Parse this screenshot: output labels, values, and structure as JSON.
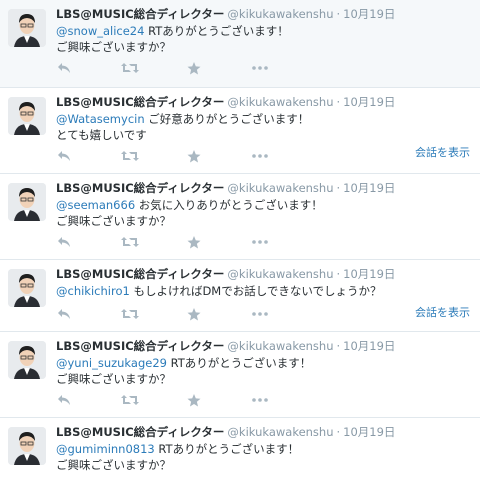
{
  "tweets": [
    {
      "name": "LBS@MUSIC総合ディレクター",
      "handle": "@kikukawakenshu",
      "separator": "·",
      "date": "10月19日",
      "mention": "@snow_alice24",
      "text1": " RTありがとうございます！",
      "text2": "ご興味ございますか？",
      "show_conversation": ""
    },
    {
      "name": "LBS@MUSIC総合ディレクター",
      "handle": "@kikukawakenshu",
      "separator": "·",
      "date": "10月19日",
      "mention": "@Watasemycin",
      "text1": " ご好意ありがとうございます！",
      "text2": "とても嬉しいです",
      "show_conversation": "会話を表示"
    },
    {
      "name": "LBS@MUSIC総合ディレクター",
      "handle": "@kikukawakenshu",
      "separator": "·",
      "date": "10月19日",
      "mention": "@seeman666",
      "text1": " お気に入りありがとうございます！",
      "text2": "ご興味ございますか？",
      "show_conversation": ""
    },
    {
      "name": "LBS@MUSIC総合ディレクター",
      "handle": "@kikukawakenshu",
      "separator": "·",
      "date": "10月19日",
      "mention": "@chikichiro1",
      "text1": " もしよければDMでお話しできないでしょうか？",
      "text2": "",
      "show_conversation": "会話を表示"
    },
    {
      "name": "LBS@MUSIC総合ディレクター",
      "handle": "@kikukawakenshu",
      "separator": "·",
      "date": "10月19日",
      "mention": "@yuni_suzukage29",
      "text1": " RTありがとうございます！",
      "text2": "ご興味ございますか？",
      "show_conversation": ""
    },
    {
      "name": "LBS@MUSIC総合ディレクター",
      "handle": "@kikukawakenshu",
      "separator": "·",
      "date": "10月19日",
      "mention": "@gumiminn0813",
      "text1": " RTありがとうございます！",
      "text2": "ご興味ございますか？",
      "show_conversation": ""
    }
  ],
  "icons": {
    "reply": "reply-icon",
    "retweet": "retweet-icon",
    "favorite": "star-icon",
    "more": "more-icon"
  },
  "colors": {
    "link": "#2b7bb9",
    "muted": "#8899a6",
    "icon": "#aab8c2",
    "highlight_bg": "#f5f8fa"
  }
}
